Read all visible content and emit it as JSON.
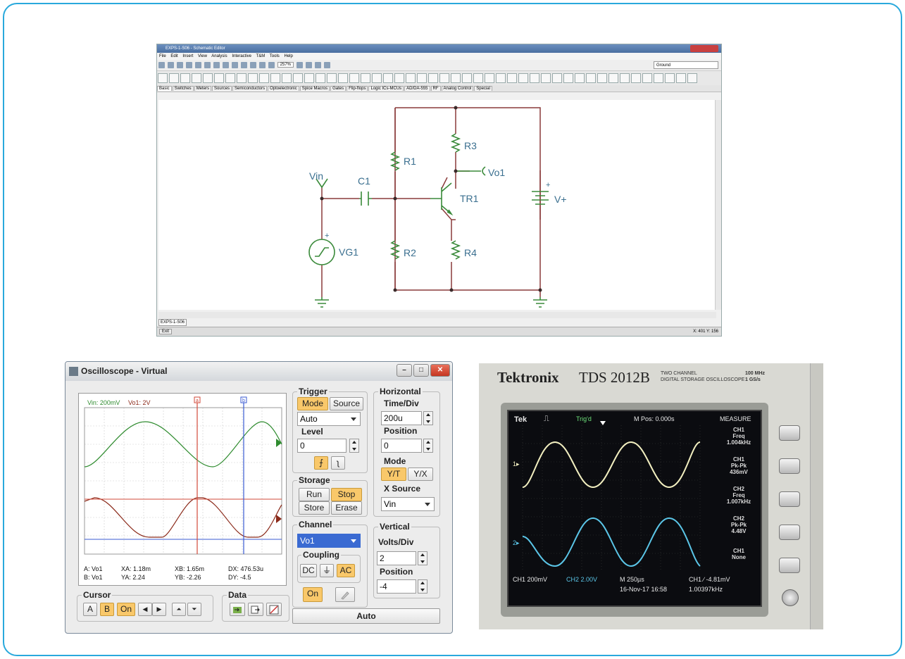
{
  "schematic_editor": {
    "title": "EXPS-1-S06 - Schematic Editor",
    "menu": [
      "File",
      "Edit",
      "Insert",
      "View",
      "Analysis",
      "Interactive",
      "T&M",
      "Tools",
      "Help"
    ],
    "zoom": "257%",
    "component_select": "Ground",
    "tabs": [
      "Basic",
      "Switches",
      "Meters",
      "Sources",
      "Semiconductors",
      "Optoelectronic",
      "Spice Macros",
      "Gates",
      "Flip-flops",
      "Logic ICs-MCUs",
      "AD/DA-555",
      "RF",
      "Analog Control",
      "Special"
    ],
    "doc_tab": "EXPS-1-S06",
    "status_exit": "Exit",
    "status_coords": "X: 401  Y: 156",
    "labels": {
      "vin": "Vin",
      "c1": "C1",
      "r1": "R1",
      "r2": "R2",
      "r3": "R3",
      "r4": "R4",
      "vo1": "Vo1",
      "tr1": "TR1",
      "vplus": "V+",
      "vg1": "VG1",
      "plus1": "+",
      "plus2": "+"
    }
  },
  "oscilloscope": {
    "title": "Oscilloscope - Virtual",
    "window_buttons": {
      "minimize": "–",
      "maximize": "□",
      "close": "✕"
    },
    "screen": {
      "ch_a": "Vin: 200mV",
      "ch_b": "Vo1: 2V",
      "cursor_a": "a",
      "cursor_b": "b"
    },
    "readout": {
      "a_src": "A:  Vo1",
      "b_src": "B:  Vo1",
      "xa": "XA:  1.18m",
      "ya": "YA:  2.24",
      "xb": "XB:  1.65m",
      "yb": "YB:  -2.26",
      "dx": "DX:  476.53u",
      "dy": "DY:  -4.5"
    },
    "trigger": {
      "label": "Trigger",
      "mode": "Mode",
      "source": "Source",
      "mode_value": "Auto",
      "level_label": "Level",
      "level_value": "0",
      "rise": "⨍",
      "fall": "ʅ"
    },
    "horizontal": {
      "label": "Horizontal",
      "time_div_label": "Time/Div",
      "time_div": "200u",
      "position_label": "Position",
      "position": "0",
      "mode_label": "Mode",
      "yt": "Y/T",
      "yx": "Y/X",
      "xsource_label": "X Source",
      "xsource": "Vin"
    },
    "storage": {
      "label": "Storage",
      "run": "Run",
      "stop": "Stop",
      "store": "Store",
      "erase": "Erase"
    },
    "channel": {
      "label": "Channel",
      "value": "Vo1",
      "coupling_label": "Coupling",
      "dc": "DC",
      "gnd": "⏚",
      "ac": "AC",
      "on": "On"
    },
    "vertical": {
      "label": "Vertical",
      "volts_div_label": "Volts/Div",
      "volts_div": "2",
      "position_label": "Position",
      "position": "-4"
    },
    "cursor": {
      "label": "Cursor",
      "a": "A",
      "b": "B",
      "on": "On",
      "left": "◀",
      "right": "▶",
      "up": "⏶",
      "down": "⏷"
    },
    "data": {
      "label": "Data"
    },
    "auto": "Auto"
  },
  "tektronix": {
    "brand": "Tektronix",
    "model": "TDS 2012B",
    "model_sub1": "TWO CHANNEL",
    "model_sub2": "DIGITAL STORAGE OSCILLOSCOPE",
    "spec1": "100 MHz",
    "spec2": "1 GS/s",
    "screen": {
      "tek": "Tek",
      "trig": "Trig'd",
      "mpos": "M Pos: 0.000s",
      "measure": "MEASURE",
      "ch1_marker": "1▸",
      "ch2_marker": "2▸",
      "m1": [
        "CH1",
        "Freq",
        "1.004kHz"
      ],
      "m2": [
        "CH1",
        "Pk-Pk",
        "436mV"
      ],
      "m3": [
        "CH2",
        "Freq",
        "1.007kHz"
      ],
      "m4": [
        "CH2",
        "Pk-Pk",
        "4.48V"
      ],
      "m5": [
        "CH1",
        "None"
      ],
      "ch1_scale": "CH1  200mV",
      "ch2_scale": "CH2  2.00V",
      "time_scale": "M 250µs",
      "trigger_info": "CH1 ∕ -4.81mV",
      "date": "16-Nov-17 16:58",
      "freq": "1.00397kHz"
    }
  },
  "colors": {
    "wire": "#8a3a3a",
    "component": "#3a8a3a",
    "label": "#3a6f8f",
    "vin_trace": "#2e8b2e",
    "vo1_trace": "#8b2a1a",
    "cursor_a": "#d24a3a",
    "cursor_b": "#3a5ad2",
    "tek_ch1": "#f2efc0",
    "tek_ch2": "#5bc6e8",
    "accent": "#f9c86a"
  }
}
